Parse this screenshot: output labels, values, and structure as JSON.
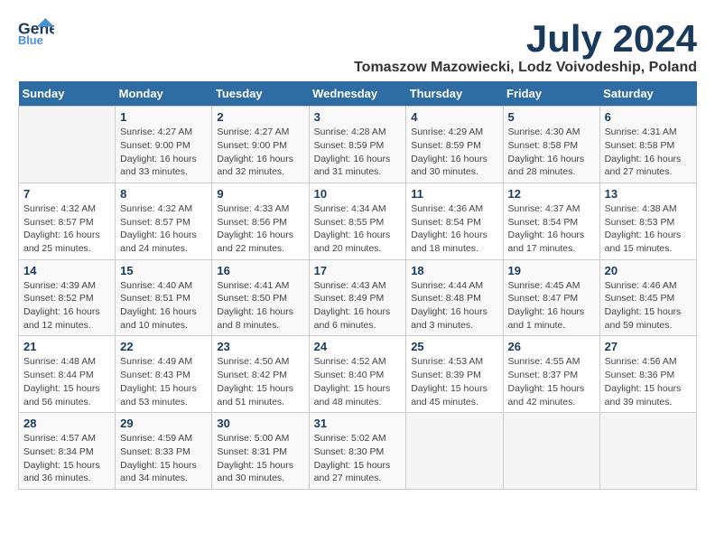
{
  "header": {
    "logo_line1": "General",
    "logo_line2": "Blue",
    "main_title": "July 2024",
    "subtitle": "Tomaszow Mazowiecki, Lodz Voivodeship, Poland"
  },
  "weekdays": [
    "Sunday",
    "Monday",
    "Tuesday",
    "Wednesday",
    "Thursday",
    "Friday",
    "Saturday"
  ],
  "weeks": [
    [
      {
        "day": "",
        "info": ""
      },
      {
        "day": "1",
        "info": "Sunrise: 4:27 AM\nSunset: 9:00 PM\nDaylight: 16 hours\nand 33 minutes."
      },
      {
        "day": "2",
        "info": "Sunrise: 4:27 AM\nSunset: 9:00 PM\nDaylight: 16 hours\nand 32 minutes."
      },
      {
        "day": "3",
        "info": "Sunrise: 4:28 AM\nSunset: 8:59 PM\nDaylight: 16 hours\nand 31 minutes."
      },
      {
        "day": "4",
        "info": "Sunrise: 4:29 AM\nSunset: 8:59 PM\nDaylight: 16 hours\nand 30 minutes."
      },
      {
        "day": "5",
        "info": "Sunrise: 4:30 AM\nSunset: 8:58 PM\nDaylight: 16 hours\nand 28 minutes."
      },
      {
        "day": "6",
        "info": "Sunrise: 4:31 AM\nSunset: 8:58 PM\nDaylight: 16 hours\nand 27 minutes."
      }
    ],
    [
      {
        "day": "7",
        "info": "Sunrise: 4:32 AM\nSunset: 8:57 PM\nDaylight: 16 hours\nand 25 minutes."
      },
      {
        "day": "8",
        "info": "Sunrise: 4:32 AM\nSunset: 8:57 PM\nDaylight: 16 hours\nand 24 minutes."
      },
      {
        "day": "9",
        "info": "Sunrise: 4:33 AM\nSunset: 8:56 PM\nDaylight: 16 hours\nand 22 minutes."
      },
      {
        "day": "10",
        "info": "Sunrise: 4:34 AM\nSunset: 8:55 PM\nDaylight: 16 hours\nand 20 minutes."
      },
      {
        "day": "11",
        "info": "Sunrise: 4:36 AM\nSunset: 8:54 PM\nDaylight: 16 hours\nand 18 minutes."
      },
      {
        "day": "12",
        "info": "Sunrise: 4:37 AM\nSunset: 8:54 PM\nDaylight: 16 hours\nand 17 minutes."
      },
      {
        "day": "13",
        "info": "Sunrise: 4:38 AM\nSunset: 8:53 PM\nDaylight: 16 hours\nand 15 minutes."
      }
    ],
    [
      {
        "day": "14",
        "info": "Sunrise: 4:39 AM\nSunset: 8:52 PM\nDaylight: 16 hours\nand 12 minutes."
      },
      {
        "day": "15",
        "info": "Sunrise: 4:40 AM\nSunset: 8:51 PM\nDaylight: 16 hours\nand 10 minutes."
      },
      {
        "day": "16",
        "info": "Sunrise: 4:41 AM\nSunset: 8:50 PM\nDaylight: 16 hours\nand 8 minutes."
      },
      {
        "day": "17",
        "info": "Sunrise: 4:43 AM\nSunset: 8:49 PM\nDaylight: 16 hours\nand 6 minutes."
      },
      {
        "day": "18",
        "info": "Sunrise: 4:44 AM\nSunset: 8:48 PM\nDaylight: 16 hours\nand 3 minutes."
      },
      {
        "day": "19",
        "info": "Sunrise: 4:45 AM\nSunset: 8:47 PM\nDaylight: 16 hours\nand 1 minute."
      },
      {
        "day": "20",
        "info": "Sunrise: 4:46 AM\nSunset: 8:45 PM\nDaylight: 15 hours\nand 59 minutes."
      }
    ],
    [
      {
        "day": "21",
        "info": "Sunrise: 4:48 AM\nSunset: 8:44 PM\nDaylight: 15 hours\nand 56 minutes."
      },
      {
        "day": "22",
        "info": "Sunrise: 4:49 AM\nSunset: 8:43 PM\nDaylight: 15 hours\nand 53 minutes."
      },
      {
        "day": "23",
        "info": "Sunrise: 4:50 AM\nSunset: 8:42 PM\nDaylight: 15 hours\nand 51 minutes."
      },
      {
        "day": "24",
        "info": "Sunrise: 4:52 AM\nSunset: 8:40 PM\nDaylight: 15 hours\nand 48 minutes."
      },
      {
        "day": "25",
        "info": "Sunrise: 4:53 AM\nSunset: 8:39 PM\nDaylight: 15 hours\nand 45 minutes."
      },
      {
        "day": "26",
        "info": "Sunrise: 4:55 AM\nSunset: 8:37 PM\nDaylight: 15 hours\nand 42 minutes."
      },
      {
        "day": "27",
        "info": "Sunrise: 4:56 AM\nSunset: 8:36 PM\nDaylight: 15 hours\nand 39 minutes."
      }
    ],
    [
      {
        "day": "28",
        "info": "Sunrise: 4:57 AM\nSunset: 8:34 PM\nDaylight: 15 hours\nand 36 minutes."
      },
      {
        "day": "29",
        "info": "Sunrise: 4:59 AM\nSunset: 8:33 PM\nDaylight: 15 hours\nand 34 minutes."
      },
      {
        "day": "30",
        "info": "Sunrise: 5:00 AM\nSunset: 8:31 PM\nDaylight: 15 hours\nand 30 minutes."
      },
      {
        "day": "31",
        "info": "Sunrise: 5:02 AM\nSunset: 8:30 PM\nDaylight: 15 hours\nand 27 minutes."
      },
      {
        "day": "",
        "info": ""
      },
      {
        "day": "",
        "info": ""
      },
      {
        "day": "",
        "info": ""
      }
    ]
  ]
}
